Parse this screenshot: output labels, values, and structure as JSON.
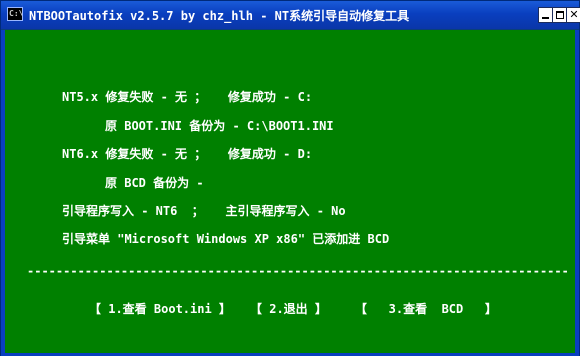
{
  "window": {
    "title": "NTBOOTautofix v2.5.7 by chz_hlh - NT系统引导自动修复工具",
    "icon_text": "C:\\"
  },
  "console": {
    "lines": [
      "NT5.x 修复失败 - 无 ；   修复成功 - C:",
      "原 BOOT.INI 备份为 - C:\\BOOT1.INI",
      "NT6.x 修复失败 - 无 ；   修复成功 - D:",
      "原 BCD 备份为 -",
      "引导程序写入 - NT6  ；   主引导程序写入 - No",
      "引导菜单 \"Microsoft Windows XP x86\" 已添加进 BCD"
    ],
    "divider": "-------------------------------------------------------------------------------------------------------------------------"
  },
  "menu": {
    "view_boot_ini": "【 1.查看 Boot.ini 】",
    "exit": "【 2.退出 】",
    "view_bcd": "【   3.查看  BCD   】"
  },
  "colors": {
    "console_bg": "#008000",
    "titlebar": "#0a3fbf",
    "text": "#ffffff"
  }
}
